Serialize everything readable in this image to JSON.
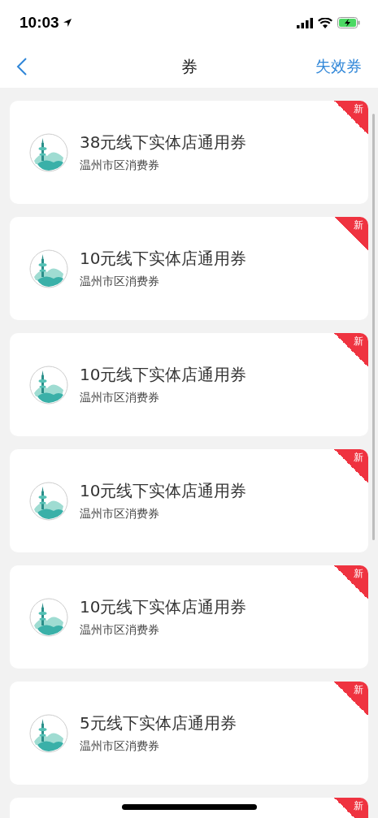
{
  "status_bar": {
    "time": "10:03"
  },
  "nav": {
    "title": "券",
    "action": "失效券"
  },
  "coupons": [
    {
      "title": "38元线下实体店通用券",
      "subtitle": "温州市区消费券",
      "badge": "新"
    },
    {
      "title": "10元线下实体店通用券",
      "subtitle": "温州市区消费券",
      "badge": "新"
    },
    {
      "title": "10元线下实体店通用券",
      "subtitle": "温州市区消费券",
      "badge": "新"
    },
    {
      "title": "10元线下实体店通用券",
      "subtitle": "温州市区消费券",
      "badge": "新"
    },
    {
      "title": "10元线下实体店通用券",
      "subtitle": "温州市区消费券",
      "badge": "新"
    },
    {
      "title": "5元线下实体店通用券",
      "subtitle": "温州市区消费券",
      "badge": "新"
    }
  ],
  "partial_card": {
    "badge": "新"
  }
}
